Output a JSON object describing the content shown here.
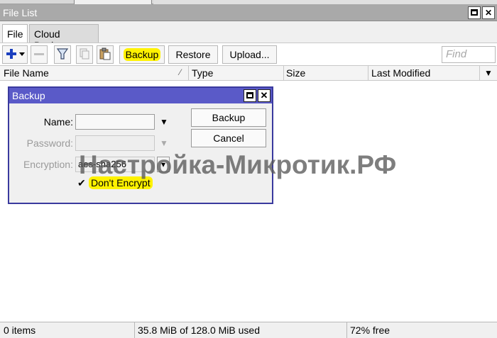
{
  "window": {
    "title": "File List"
  },
  "tabs": [
    {
      "label": "File",
      "active": true
    },
    {
      "label": "Cloud Backup",
      "active": false
    }
  ],
  "toolbar": {
    "add_icon": "plus-icon",
    "remove_icon": "minus-icon",
    "filter_icon": "filter-icon",
    "copy_icon": "copy-icon",
    "paste_icon": "paste-icon",
    "backup_label": "Backup",
    "restore_label": "Restore",
    "upload_label": "Upload...",
    "find_placeholder": "Find"
  },
  "columns": [
    {
      "label": "File Name"
    },
    {
      "label": "Type"
    },
    {
      "label": "Size"
    },
    {
      "label": "Last Modified"
    }
  ],
  "status": {
    "items": "0 items",
    "used": "35.8 MiB of 128.0 MiB used",
    "free": "72% free"
  },
  "dialog": {
    "title": "Backup",
    "name_label": "Name:",
    "name_value": "",
    "password_label": "Password:",
    "password_value": "",
    "encryption_label": "Encryption:",
    "encryption_value": "aes-sha256",
    "dont_encrypt_label": "Don't Encrypt",
    "dont_encrypt_checked": true,
    "backup_button": "Backup",
    "cancel_button": "Cancel"
  },
  "watermark": "Настройка-Микротик.РФ",
  "colors": {
    "titlebar": "#a9a9a9",
    "dialog_titlebar": "#5a5ac8",
    "highlight": "#fff200",
    "accent_add": "#1a3fbf"
  }
}
